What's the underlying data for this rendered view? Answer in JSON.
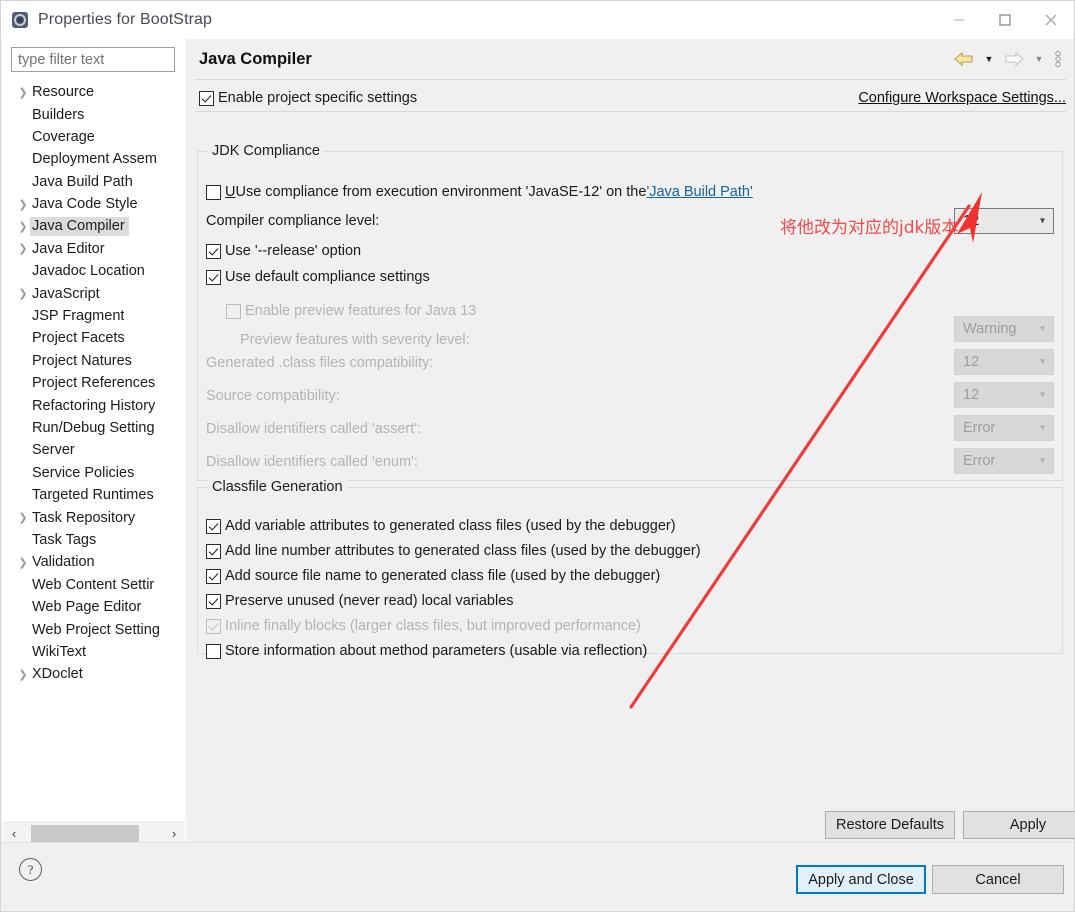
{
  "window": {
    "title": "Properties for BootStrap",
    "icon": "properties-gear-icon",
    "minimize_label": "–",
    "maximize_label": "□",
    "close_label": "✕"
  },
  "sidebar": {
    "filter": {
      "value": "",
      "placeholder": "type filter text"
    },
    "items": [
      {
        "label": "Resource",
        "expandable": true,
        "selected": false
      },
      {
        "label": "Builders",
        "expandable": false,
        "selected": false
      },
      {
        "label": "Coverage",
        "expandable": false,
        "selected": false
      },
      {
        "label": "Deployment Assem",
        "expandable": false,
        "selected": false
      },
      {
        "label": "Java Build Path",
        "expandable": false,
        "selected": false
      },
      {
        "label": "Java Code Style",
        "expandable": true,
        "selected": false
      },
      {
        "label": "Java Compiler",
        "expandable": true,
        "selected": true
      },
      {
        "label": "Java Editor",
        "expandable": true,
        "selected": false
      },
      {
        "label": "Javadoc Location",
        "expandable": false,
        "selected": false
      },
      {
        "label": "JavaScript",
        "expandable": true,
        "selected": false
      },
      {
        "label": "JSP Fragment",
        "expandable": false,
        "selected": false
      },
      {
        "label": "Project Facets",
        "expandable": false,
        "selected": false
      },
      {
        "label": "Project Natures",
        "expandable": false,
        "selected": false
      },
      {
        "label": "Project References",
        "expandable": false,
        "selected": false
      },
      {
        "label": "Refactoring History",
        "expandable": false,
        "selected": false
      },
      {
        "label": "Run/Debug Setting",
        "expandable": false,
        "selected": false
      },
      {
        "label": "Server",
        "expandable": false,
        "selected": false
      },
      {
        "label": "Service Policies",
        "expandable": false,
        "selected": false
      },
      {
        "label": "Targeted Runtimes",
        "expandable": false,
        "selected": false
      },
      {
        "label": "Task Repository",
        "expandable": true,
        "selected": false
      },
      {
        "label": "Task Tags",
        "expandable": false,
        "selected": false
      },
      {
        "label": "Validation",
        "expandable": true,
        "selected": false
      },
      {
        "label": "Web Content Settir",
        "expandable": false,
        "selected": false
      },
      {
        "label": "Web Page Editor",
        "expandable": false,
        "selected": false
      },
      {
        "label": "Web Project Setting",
        "expandable": false,
        "selected": false
      },
      {
        "label": "WikiText",
        "expandable": false,
        "selected": false
      },
      {
        "label": "XDoclet",
        "expandable": true,
        "selected": false
      }
    ],
    "scroll_left_label": "‹",
    "scroll_right_label": "›"
  },
  "main": {
    "page_title": "Java Compiler",
    "nav": {
      "back_icon": "back-arrow-icon",
      "back_dropdown_icon": "chevron-down-icon",
      "forward_icon": "forward-arrow-icon",
      "forward_dropdown_icon": "chevron-down-icon",
      "menu_icon": "view-menu-icon"
    },
    "enable_project_specific": {
      "label": "Enable project specific settings",
      "checked": true
    },
    "configure_workspace_link": "Configure Workspace Settings...",
    "jdk_compliance": {
      "title": "JDK Compliance",
      "use_execution_env": {
        "label_before": "Use compliance from execution environment 'JavaSE-12' on the ",
        "link": "'Java Build Path'",
        "checked": false
      },
      "compliance_level": {
        "label": "Compiler compliance level:",
        "value": "12",
        "enabled": true
      },
      "use_release_option": {
        "label": "Use '--release' option",
        "checked": true
      },
      "use_default_compliance": {
        "label": "Use default compliance settings",
        "checked": true
      },
      "enable_preview": {
        "label": "Enable preview features for Java 13",
        "checked": false,
        "enabled": false
      },
      "preview_severity": {
        "label": "Preview features with severity level:",
        "value": "Warning",
        "enabled": false
      },
      "class_files_compat": {
        "label": "Generated .class files compatibility:",
        "value": "12",
        "enabled": false
      },
      "source_compat": {
        "label": "Source compatibility:",
        "value": "12",
        "enabled": false
      },
      "disallow_assert": {
        "label": "Disallow identifiers called 'assert':",
        "value": "Error",
        "enabled": false
      },
      "disallow_enum": {
        "label": "Disallow identifiers called 'enum':",
        "value": "Error",
        "enabled": false
      }
    },
    "classfile_generation": {
      "title": "Classfile Generation",
      "options": [
        {
          "label": "Add variable attributes to generated class files (used by the debugger)",
          "checked": true,
          "enabled": true
        },
        {
          "label": "Add line number attributes to generated class files (used by the debugger)",
          "checked": true,
          "enabled": true
        },
        {
          "label": "Add source file name to generated class file (used by the debugger)",
          "checked": true,
          "enabled": true
        },
        {
          "label": "Preserve unused (never read) local variables",
          "checked": true,
          "enabled": true
        },
        {
          "label": "Inline finally blocks (larger class files, but improved performance)",
          "checked": true,
          "enabled": false
        },
        {
          "label": "Store information about method parameters (usable via reflection)",
          "checked": false,
          "enabled": true
        }
      ]
    },
    "restore_defaults_label": "Restore Defaults",
    "apply_label": "Apply"
  },
  "footer": {
    "help_icon": "help-question-icon",
    "help_label": "?",
    "apply_and_close_label": "Apply and Close",
    "cancel_label": "Cancel"
  },
  "annotation": {
    "text": "将他改为对应的jdk版本",
    "color": "#f04a4a",
    "arrow_color": "#ee3b3b"
  }
}
